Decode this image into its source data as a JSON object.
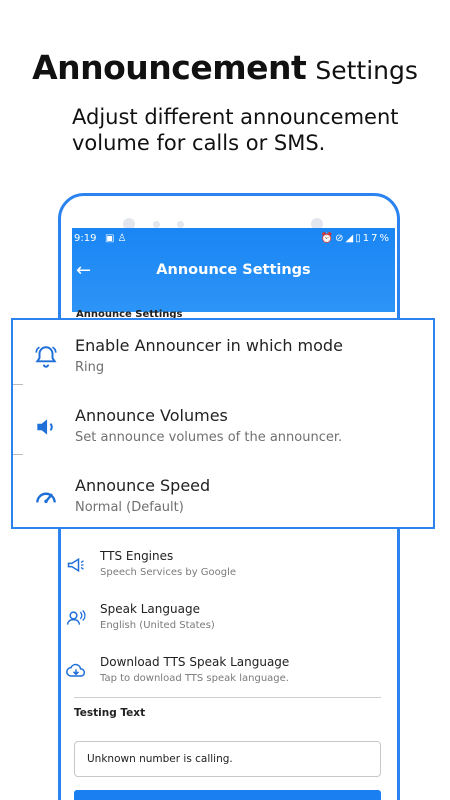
{
  "headline": {
    "strong": "Announcement",
    "light": "Settings"
  },
  "subline": "Adjust different announcement volume for calls or SMS.",
  "status_bar": {
    "time": "9:19",
    "battery": "17%"
  },
  "appbar": {
    "title": "Announce Settings"
  },
  "section_peek": "Announce Settings",
  "popup_items": [
    {
      "title": "Enable Announcer in which mode",
      "subtitle": "Ring",
      "icon": "bell-icon"
    },
    {
      "title": "Announce Volumes",
      "subtitle": "Set announce volumes of the announcer.",
      "icon": "speaker-icon"
    },
    {
      "title": "Announce Speed",
      "subtitle": "Normal (Default)",
      "icon": "speedometer-icon"
    }
  ],
  "list_items": [
    {
      "title": "TTS Engines",
      "subtitle": "Speech Services by Google",
      "icon": "megaphone-icon"
    },
    {
      "title": "Speak Language",
      "subtitle": "English (United States)",
      "icon": "person-voice-icon"
    },
    {
      "title": "Download TTS Speak Language",
      "subtitle": "Tap to download TTS speak language.",
      "icon": "download-icon"
    }
  ],
  "testing": {
    "label": "Testing Text",
    "value": "Unknown number is calling."
  },
  "colors": {
    "accent": "#2a83ee",
    "appbar": "#1a86f4",
    "icon": "#1f6fd8"
  }
}
